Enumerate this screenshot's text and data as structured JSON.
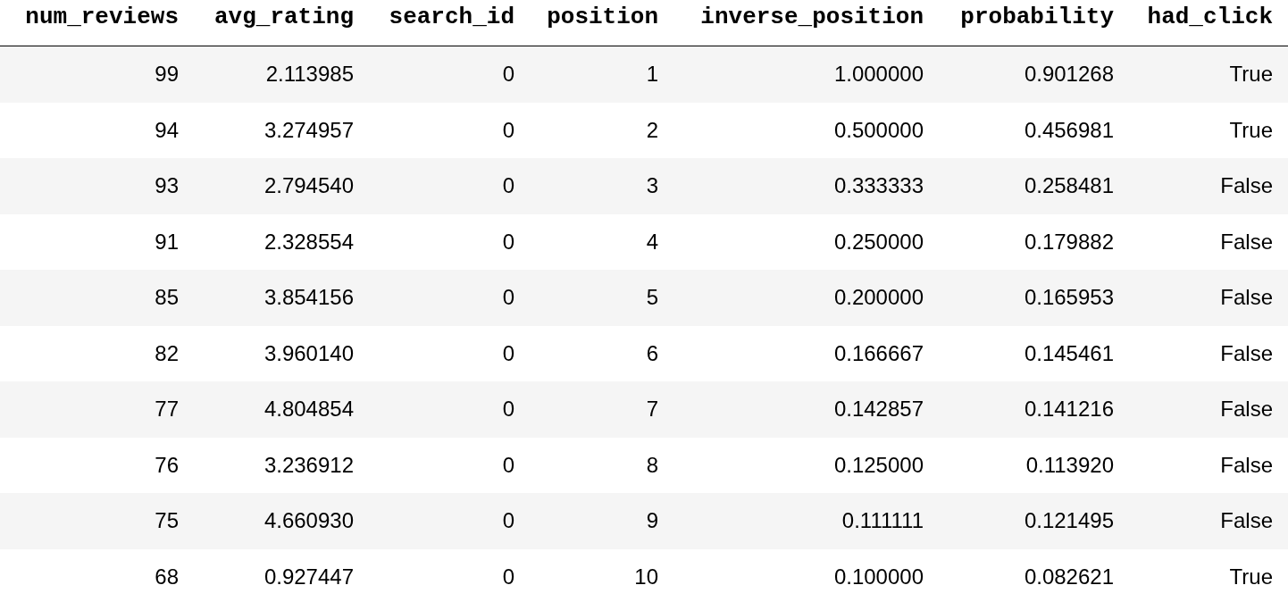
{
  "table": {
    "columns": [
      "num_reviews",
      "avg_rating",
      "search_id",
      "position",
      "inverse_position",
      "probability",
      "had_click"
    ],
    "rows": [
      [
        "99",
        "2.113985",
        "0",
        "1",
        "1.000000",
        "0.901268",
        "True"
      ],
      [
        "94",
        "3.274957",
        "0",
        "2",
        "0.500000",
        "0.456981",
        "True"
      ],
      [
        "93",
        "2.794540",
        "0",
        "3",
        "0.333333",
        "0.258481",
        "False"
      ],
      [
        "91",
        "2.328554",
        "0",
        "4",
        "0.250000",
        "0.179882",
        "False"
      ],
      [
        "85",
        "3.854156",
        "0",
        "5",
        "0.200000",
        "0.165953",
        "False"
      ],
      [
        "82",
        "3.960140",
        "0",
        "6",
        "0.166667",
        "0.145461",
        "False"
      ],
      [
        "77",
        "4.804854",
        "0",
        "7",
        "0.142857",
        "0.141216",
        "False"
      ],
      [
        "76",
        "3.236912",
        "0",
        "8",
        "0.125000",
        "0.113920",
        "False"
      ],
      [
        "75",
        "4.660930",
        "0",
        "9",
        "0.111111",
        "0.121495",
        "False"
      ],
      [
        "68",
        "0.927447",
        "0",
        "10",
        "0.100000",
        "0.082621",
        "True"
      ]
    ]
  }
}
